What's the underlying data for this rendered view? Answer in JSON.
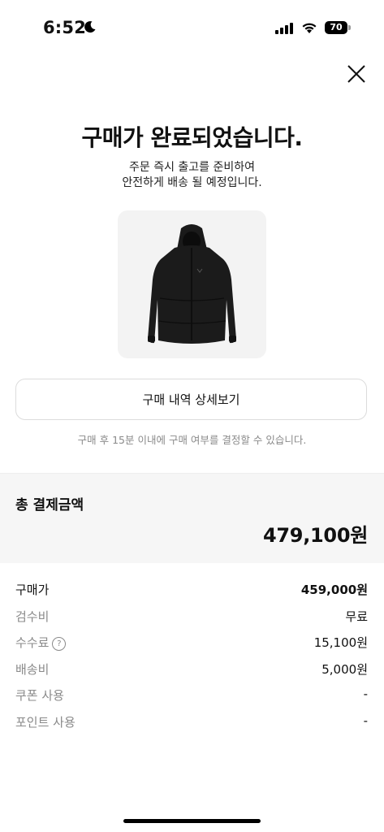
{
  "status_bar": {
    "time": "6:52",
    "battery": "70"
  },
  "header": {
    "close_icon": "close-icon"
  },
  "confirmation": {
    "title": "구매가 완료되었습니다.",
    "subtitle_line1": "주문 즉시 출고를 준비하여",
    "subtitle_line2": "안전하게 배송 될 예정입니다."
  },
  "product": {
    "image": "black-padded-jacket"
  },
  "actions": {
    "detail_button": "구매 내역 상세보기"
  },
  "notice": "구매 후 15분 이내에 구매 여부를 결정할 수 있습니다.",
  "total": {
    "label": "총 결제금액",
    "amount": "479,100원"
  },
  "breakdown": [
    {
      "label": "구매가",
      "value": "459,000원"
    },
    {
      "label": "검수비",
      "value": "무료"
    },
    {
      "label": "수수료",
      "value": "15,100원",
      "help": "?"
    },
    {
      "label": "배송비",
      "value": "5,000원"
    },
    {
      "label": "쿠폰 사용",
      "value": "-"
    },
    {
      "label": "포인트 사용",
      "value": "-"
    }
  ]
}
